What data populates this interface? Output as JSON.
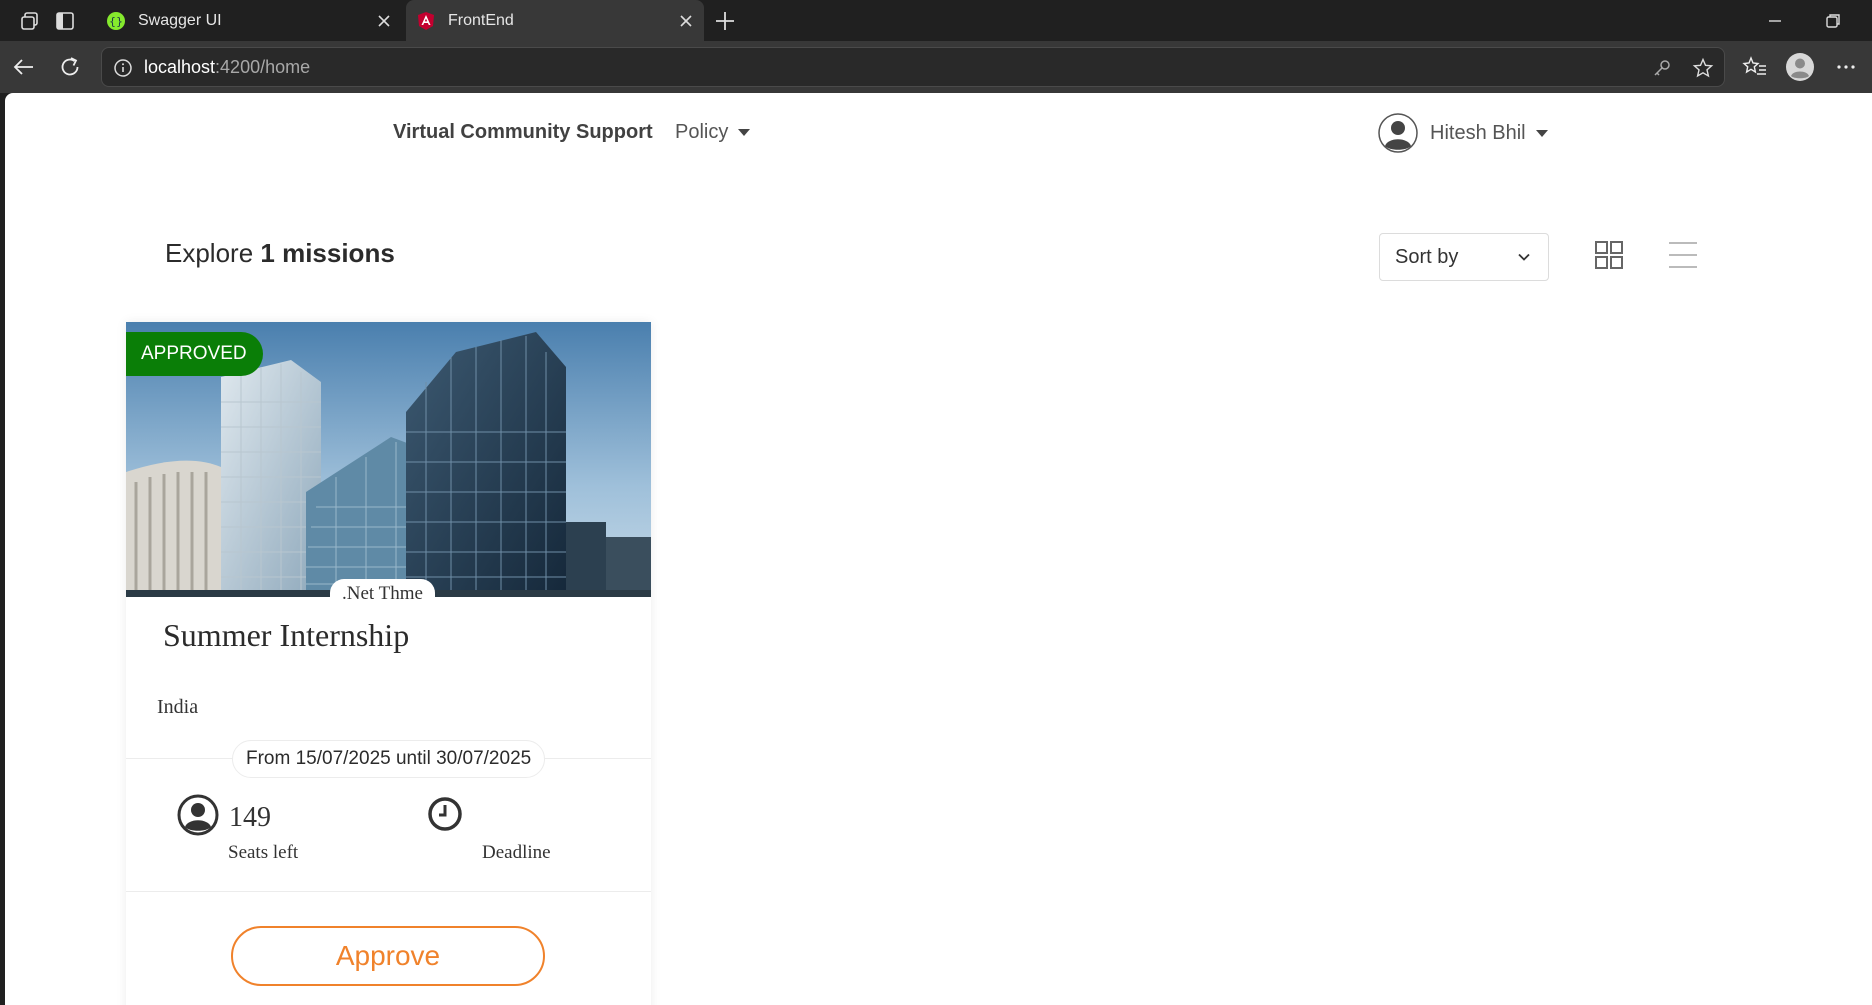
{
  "browser": {
    "tabs": [
      {
        "title": "Swagger UI",
        "active": false
      },
      {
        "title": "FrontEnd",
        "active": true
      }
    ],
    "url_host": "localhost",
    "url_rest": ":4200/home"
  },
  "navbar": {
    "brand": "Virtual Community Support",
    "policy": "Policy",
    "user_name": "Hitesh Bhil"
  },
  "toolbar": {
    "explore_prefix": "Explore",
    "explore_count": "1 missions",
    "sort_label": "Sort by"
  },
  "mission": {
    "status": "APPROVED",
    "theme": ".Net Thme",
    "title": "Summer Internship",
    "location": "India",
    "dates": "From 15/07/2025 until 30/07/2025",
    "seats_count": "149",
    "seats_label": "Seats left",
    "deadline_label": "Deadline",
    "approve_label": "Approve"
  },
  "colors": {
    "approved_badge": "#0a7e07",
    "accent_orange": "#f0822b"
  }
}
